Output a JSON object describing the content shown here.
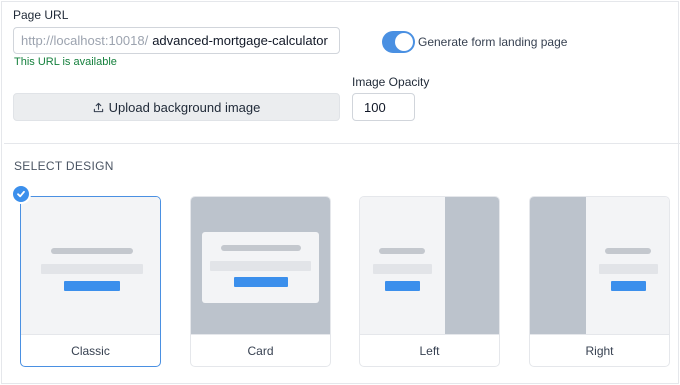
{
  "page_url": {
    "label": "Page URL",
    "prefix": "http://localhost:10018/",
    "slug": "advanced-mortgage-calculator",
    "status": "This URL is available"
  },
  "landing_toggle": {
    "label": "Generate form landing page",
    "enabled": true
  },
  "upload": {
    "label": "Upload background image",
    "icon": "upload-icon"
  },
  "opacity": {
    "label": "Image Opacity",
    "value": "100"
  },
  "design": {
    "title": "SELECT DESIGN",
    "selected": "Classic",
    "options": [
      {
        "label": "Classic"
      },
      {
        "label": "Card"
      },
      {
        "label": "Left"
      },
      {
        "label": "Right"
      }
    ]
  },
  "colors": {
    "accent": "#3b8fec",
    "status_ok": "#15803d"
  }
}
